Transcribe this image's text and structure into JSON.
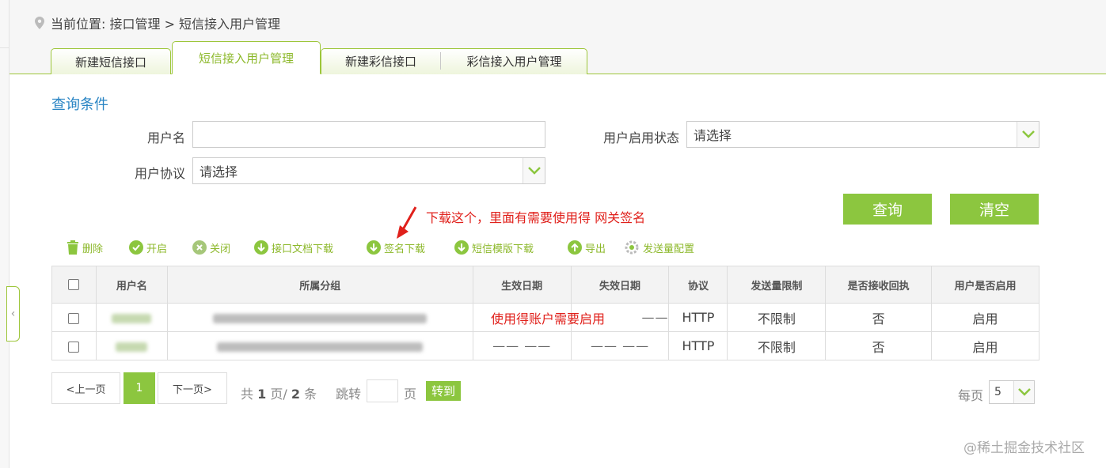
{
  "breadcrumb": {
    "text": "当前位置: 接口管理 > 短信接入用户管理"
  },
  "tabs": [
    {
      "label": "新建短信接口"
    },
    {
      "label": "短信接入用户管理"
    },
    {
      "label": "新建彩信接口"
    },
    {
      "label": "彩信接入用户管理"
    }
  ],
  "query": {
    "title": "查询条件",
    "username_label": "用户名",
    "username_value": "",
    "status_label": "用户启用状态",
    "status_value": "请选择",
    "protocol_label": "用户协议",
    "protocol_value": "请选择",
    "search_button": "查询",
    "clear_button": "清空"
  },
  "annotation": {
    "text": "下载这个，里面有需要使用得 网关签名",
    "row_note": "使用得账户需要启用"
  },
  "toolbar": {
    "delete": "删除",
    "enable": "开启",
    "disable": "关闭",
    "doc_download": "接口文档下载",
    "sign_download": "签名下载",
    "template_download": "短信模版下载",
    "export": "导出",
    "send_config": "发送量配置"
  },
  "table": {
    "headers": [
      "用户名",
      "所属分组",
      "生效日期",
      "失效日期",
      "协议",
      "发送量限制",
      "是否接收回执",
      "用户是否启用"
    ],
    "rows": [
      {
        "start": "",
        "end": "——",
        "protocol": "HTTP",
        "limit": "不限制",
        "receipt": "否",
        "enabled": "启用"
      },
      {
        "start": "—— ——",
        "end": "—— ——",
        "protocol": "HTTP",
        "limit": "不限制",
        "receipt": "否",
        "enabled": "启用"
      }
    ]
  },
  "pager": {
    "prev": "<上一页",
    "current": "1",
    "next": "下一页>",
    "total_prefix": "共",
    "total_pages": "1",
    "pages_suffix": "页/",
    "total_items": "2",
    "items_suffix": "条",
    "jump_label": "跳转",
    "jump_suffix": "页",
    "go": "转到",
    "per_page_label": "每页",
    "per_page_value": "5"
  },
  "watermark": "@稀土掘金技术社区",
  "colors": {
    "accent": "#8cc63f",
    "link": "#2a85c4",
    "annotation": "#e0201b"
  }
}
